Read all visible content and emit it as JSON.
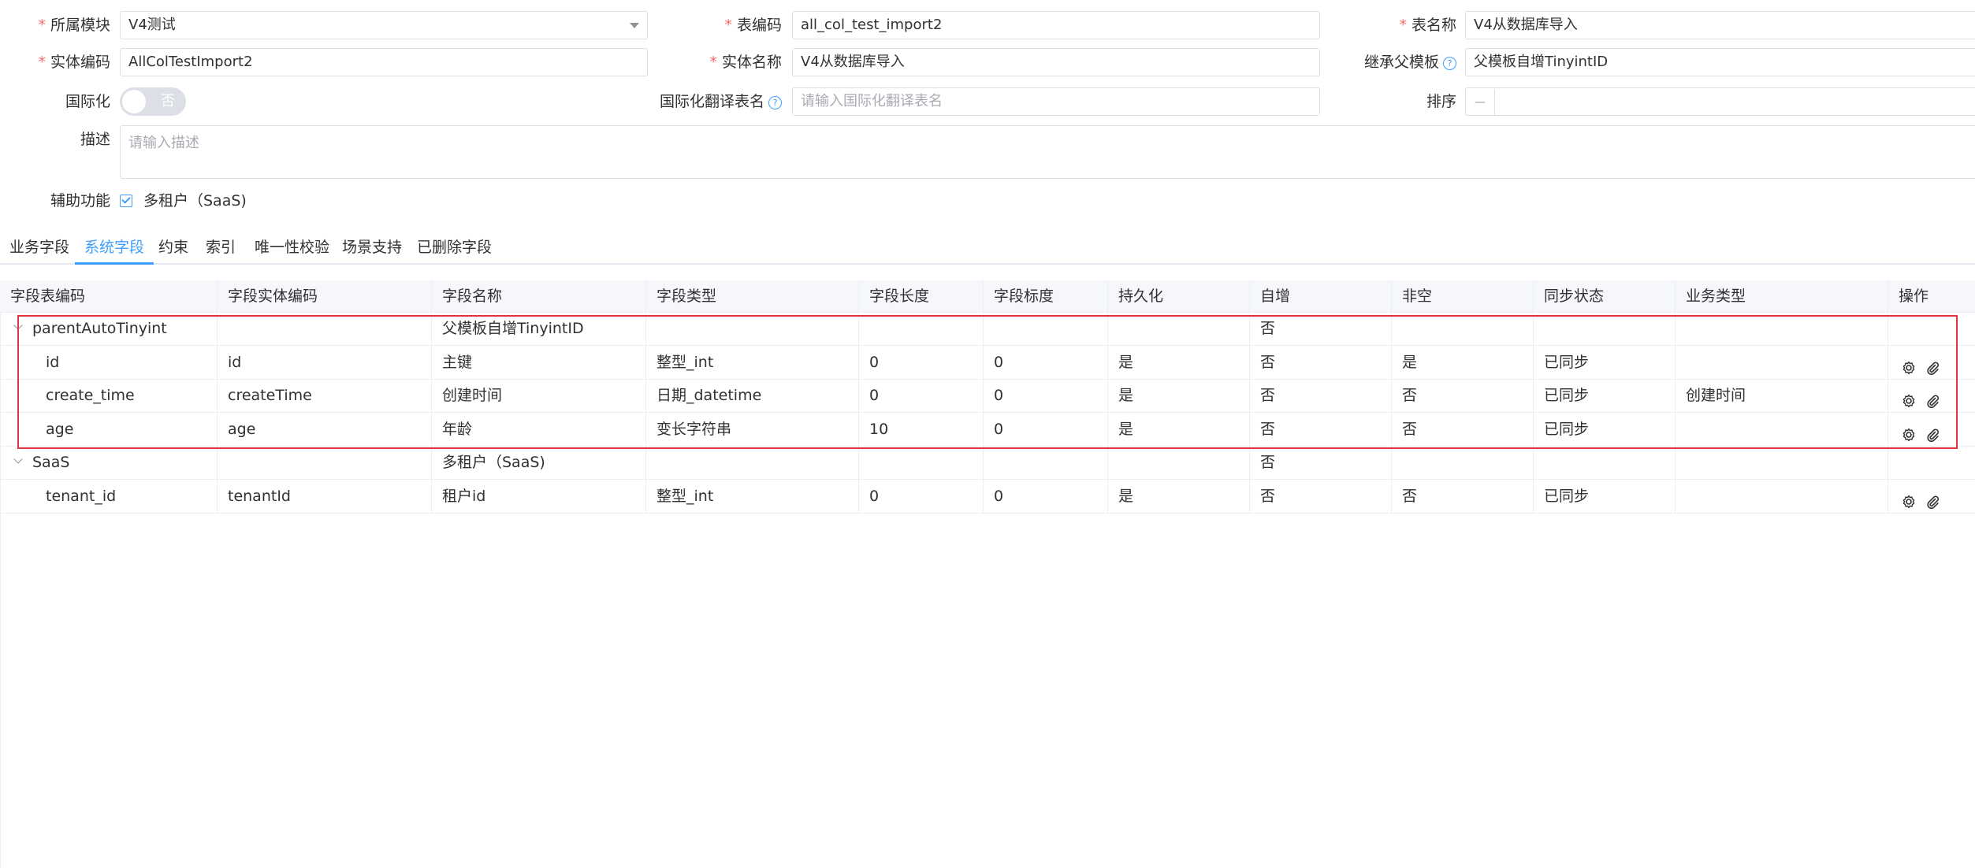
{
  "form": {
    "module": {
      "label": "所属模块",
      "value": "V4测试"
    },
    "table_code": {
      "label": "表编码",
      "value": "all_col_test_import2"
    },
    "table_name": {
      "label": "表名称",
      "value": "V4从数据库导入"
    },
    "entity_code": {
      "label": "实体编码",
      "value": "AllColTestImport2"
    },
    "entity_name": {
      "label": "实体名称",
      "value": "V4从数据库导入"
    },
    "parent_template": {
      "label": "继承父模板",
      "value": "父模板自增TinyintID"
    },
    "i18n": {
      "label": "国际化",
      "switch_text": "否"
    },
    "i18n_table": {
      "label": "国际化翻译表名",
      "placeholder": "请输入国际化翻译表名"
    },
    "sort": {
      "label": "排序",
      "minus": "—"
    },
    "description": {
      "label": "描述",
      "placeholder": "请输入描述"
    },
    "aux": {
      "label": "辅助功能",
      "option": "多租户（SaaS)"
    }
  },
  "tabs": [
    "业务字段",
    "系统字段",
    "约束",
    "索引",
    "唯一性校验",
    "场景支持",
    "已删除字段"
  ],
  "active_tab": 1,
  "table": {
    "headers": [
      "字段表编码",
      "字段实体编码",
      "字段名称",
      "字段类型",
      "字段长度",
      "字段标度",
      "持久化",
      "自增",
      "非空",
      "同步状态",
      "业务类型",
      "操作"
    ],
    "rows": [
      {
        "group": true,
        "cells": [
          "parentAutoTinyint",
          "",
          "父模板自增TinyintID",
          "",
          "",
          "",
          "",
          "否",
          "",
          "",
          "",
          ""
        ]
      },
      {
        "group": false,
        "cells": [
          "id",
          "id",
          "主键",
          "整型_int",
          "0",
          "0",
          "是",
          "否",
          "是",
          "已同步",
          "",
          ""
        ]
      },
      {
        "group": false,
        "cells": [
          "create_time",
          "createTime",
          "创建时间",
          "日期_datetime",
          "0",
          "0",
          "是",
          "否",
          "否",
          "已同步",
          "创建时间",
          ""
        ]
      },
      {
        "group": false,
        "cells": [
          "age",
          "age",
          "年龄",
          "变长字符串",
          "10",
          "0",
          "是",
          "否",
          "否",
          "已同步",
          "",
          ""
        ]
      },
      {
        "group": true,
        "cells": [
          "SaaS",
          "",
          "多租户（SaaS)",
          "",
          "",
          "",
          "",
          "否",
          "",
          "",
          "",
          ""
        ]
      },
      {
        "group": false,
        "cells": [
          "tenant_id",
          "tenantId",
          "租户id",
          "整型_int",
          "0",
          "0",
          "是",
          "否",
          "否",
          "已同步",
          "",
          ""
        ]
      }
    ]
  },
  "colors": {
    "accent": "#409eff",
    "required": "#f56c6c",
    "highlight_box": "#e0333f"
  }
}
